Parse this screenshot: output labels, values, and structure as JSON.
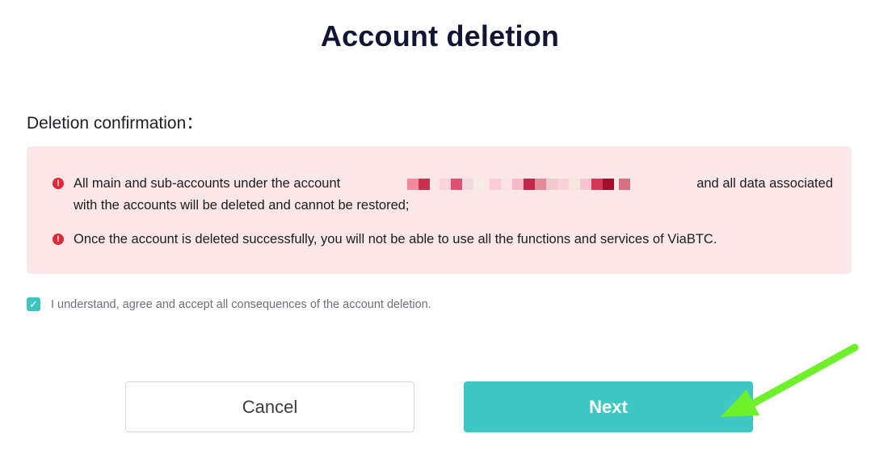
{
  "title": "Account deletion",
  "section_label": "Deletion confirmation：",
  "warnings": [
    {
      "prefix": "All main and sub-accounts under the account",
      "suffix": "and all data associated",
      "line2": "with the accounts will be deleted and cannot be restored;"
    },
    {
      "text": "Once the account is deleted successfully, you will not be able to use all the functions and services of ViaBTC."
    }
  ],
  "agreement": {
    "checked": true,
    "label": "I understand, agree and accept all consequences of the account deletion."
  },
  "buttons": {
    "cancel": "Cancel",
    "next": "Next"
  },
  "icons": {
    "warning": "exclamation-circle-icon",
    "checkbox": "checkmark-icon",
    "annotation": "green-arrow-icon"
  },
  "colors": {
    "accent": "#3fc7c4",
    "warning_bg": "#fbe6e8",
    "warning_icon": "#e0283b",
    "title": "#121634",
    "annotation_arrow": "#6ef02a"
  }
}
